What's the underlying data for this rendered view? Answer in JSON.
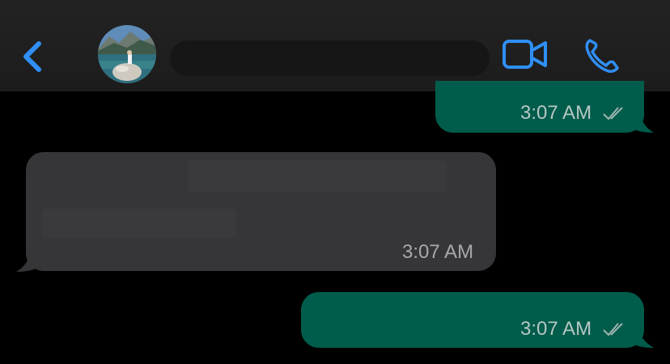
{
  "header": {
    "back_icon": "chevron-left-icon",
    "contact_name": "",
    "video_call_icon": "video-camera-icon",
    "voice_call_icon": "phone-icon",
    "accent_color": "#2f8ff5"
  },
  "messages": [
    {
      "direction": "outgoing",
      "text": "",
      "time": "3:07 AM",
      "status": "read"
    },
    {
      "direction": "incoming",
      "text": "",
      "time": "3:07 AM"
    },
    {
      "direction": "outgoing",
      "text": "",
      "time": "3:07 AM",
      "status": "read"
    }
  ],
  "colors": {
    "outgoing_bubble": "#005c4b",
    "incoming_bubble": "#363638",
    "background": "#000000"
  }
}
